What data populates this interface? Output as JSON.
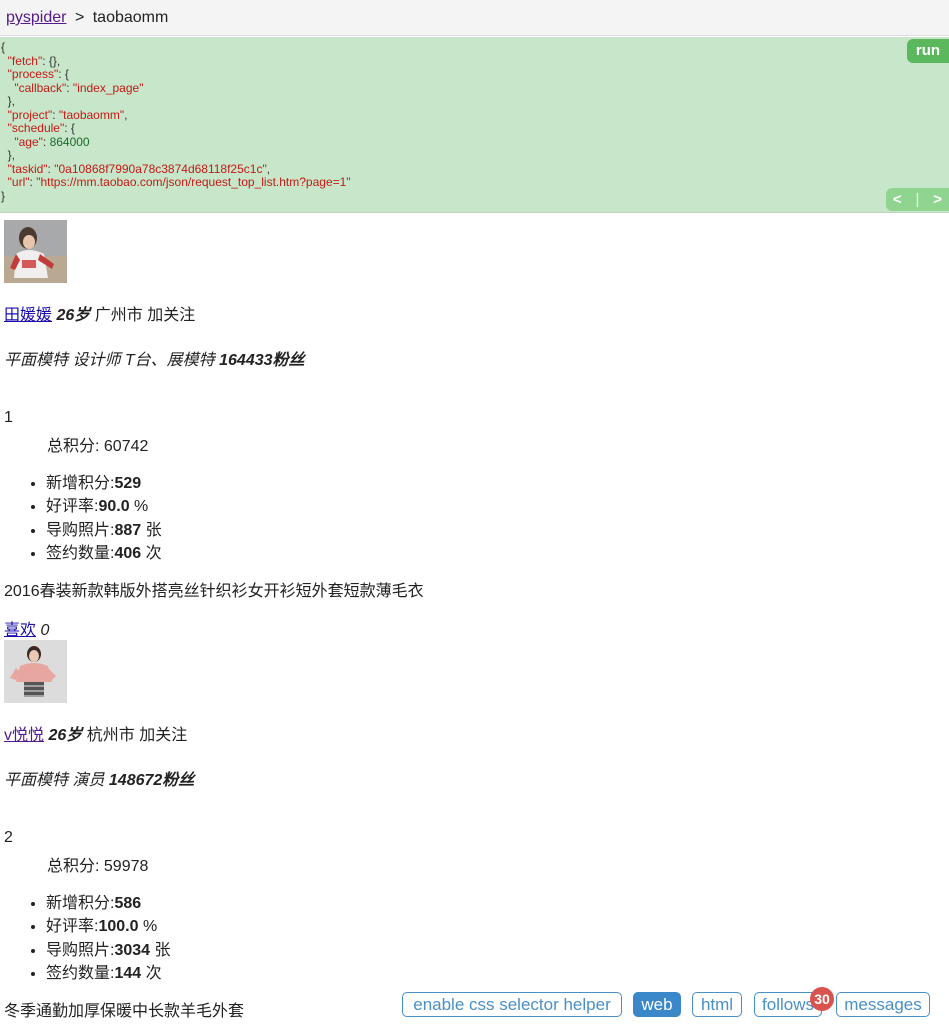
{
  "breadcrumb": {
    "root": "pyspider",
    "separator": ">",
    "project": "taobaomm"
  },
  "task_panel": {
    "json_lines": [
      [
        [
          "p",
          "{"
        ]
      ],
      [
        [
          "p",
          "  "
        ],
        [
          "s",
          "\"fetch\""
        ],
        [
          "p",
          ": {},"
        ]
      ],
      [
        [
          "p",
          "  "
        ],
        [
          "s",
          "\"process\""
        ],
        [
          "p",
          ": {"
        ]
      ],
      [
        [
          "p",
          "    "
        ],
        [
          "s",
          "\"callback\""
        ],
        [
          "p",
          ": "
        ],
        [
          "s",
          "\"index_page\""
        ]
      ],
      [
        [
          "p",
          "  },"
        ]
      ],
      [
        [
          "p",
          "  "
        ],
        [
          "s",
          "\"project\""
        ],
        [
          "p",
          ": "
        ],
        [
          "s",
          "\"taobaomm\""
        ],
        [
          "p",
          ","
        ]
      ],
      [
        [
          "p",
          "  "
        ],
        [
          "s",
          "\"schedule\""
        ],
        [
          "p",
          ": {"
        ]
      ],
      [
        [
          "p",
          "    "
        ],
        [
          "s",
          "\"age\""
        ],
        [
          "p",
          ": "
        ],
        [
          "n",
          "864000"
        ]
      ],
      [
        [
          "p",
          "  },"
        ]
      ],
      [
        [
          "p",
          "  "
        ],
        [
          "s",
          "\"taskid\""
        ],
        [
          "p",
          ": "
        ],
        [
          "s",
          "\"0a10868f7990a78c3874d68118f25c1c\""
        ],
        [
          "p",
          ","
        ]
      ],
      [
        [
          "p",
          "  "
        ],
        [
          "s",
          "\"url\""
        ],
        [
          "p",
          ": "
        ],
        [
          "s",
          "\"https://mm.taobao.com/json/request_top_list.htm?page=1\""
        ]
      ],
      [
        [
          "p",
          "}"
        ]
      ]
    ],
    "run_label": "run",
    "prev_label": "<",
    "pager_sep": "|",
    "next_label": ">"
  },
  "entries": [
    {
      "name": "田媛媛",
      "age": "26岁",
      "city": "广州市",
      "follow": "加关注",
      "tags": "平面模特 设计师 T台、展模特",
      "fans": "164433粉丝",
      "rank": "1",
      "score": "总积分: 60742",
      "stats": [
        {
          "label": "新增积分:",
          "value": "529",
          "unit": ""
        },
        {
          "label": "好评率:",
          "value": "90.0",
          "unit": " %"
        },
        {
          "label": "导购照片:",
          "value": "887",
          "unit": " 张"
        },
        {
          "label": "签约数量:",
          "value": "406",
          "unit": " 次"
        }
      ],
      "item_title": "2016春装新款韩版外搭亮丝针织衫女开衫短外套短款薄毛衣",
      "like_label": "喜欢",
      "like_count": "0"
    },
    {
      "name": "v悦悦",
      "age": "26岁",
      "city": "杭州市",
      "follow": "加关注",
      "tags": "平面模特 演员",
      "fans": "148672粉丝",
      "rank": "2",
      "score": "总积分: 59978",
      "stats": [
        {
          "label": "新增积分:",
          "value": "586",
          "unit": ""
        },
        {
          "label": "好评率:",
          "value": "100.0",
          "unit": " %"
        },
        {
          "label": "导购照片:",
          "value": "3034",
          "unit": " 张"
        },
        {
          "label": "签约数量:",
          "value": "144",
          "unit": " 次"
        }
      ],
      "item_title": "冬季通勤加厚保暖中长款羊毛外套"
    }
  ],
  "toolbar": {
    "css_helper": "enable css selector helper",
    "web": "web",
    "html": "html",
    "follows": "follows",
    "follows_count": "30",
    "messages": "messages"
  },
  "colors": {
    "task_bg": "#c8e6c9",
    "run_green": "#5cb85c",
    "link_blue": "#1a0dab",
    "toolbar_blue": "#3a87c9",
    "badge_red": "#d9534f"
  }
}
